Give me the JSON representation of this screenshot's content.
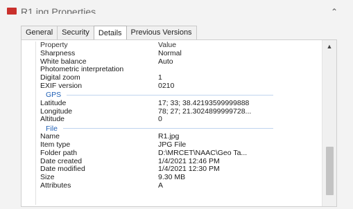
{
  "window": {
    "title": "R1.jpg Properties"
  },
  "tabs": [
    {
      "label": "General"
    },
    {
      "label": "Security"
    },
    {
      "label": "Details"
    },
    {
      "label": "Previous Versions"
    }
  ],
  "columns": {
    "property": "Property",
    "value": "Value"
  },
  "rows_image": [
    {
      "prop": "Sharpness",
      "val": "Normal"
    },
    {
      "prop": "White balance",
      "val": "Auto"
    },
    {
      "prop": "Photometric interpretation",
      "val": ""
    },
    {
      "prop": "Digital zoom",
      "val": "1"
    },
    {
      "prop": "EXIF version",
      "val": "0210"
    }
  ],
  "group_gps": "GPS",
  "rows_gps": [
    {
      "prop": "Latitude",
      "val": "17; 33; 38.42193599999888"
    },
    {
      "prop": "Longitude",
      "val": "78; 27; 21.3024899999728..."
    },
    {
      "prop": "Altitude",
      "val": "0"
    }
  ],
  "group_file": "File",
  "rows_file": [
    {
      "prop": "Name",
      "val": "R1.jpg"
    },
    {
      "prop": "Item type",
      "val": "JPG File"
    },
    {
      "prop": "Folder path",
      "val": "D:\\MRCET\\NAAC\\Geo Ta..."
    },
    {
      "prop": "Date created",
      "val": "1/4/2021 12:46 PM"
    },
    {
      "prop": "Date modified",
      "val": "1/4/2021 12:30 PM"
    },
    {
      "prop": "Size",
      "val": "9.30 MB"
    },
    {
      "prop": "Attributes",
      "val": "A"
    }
  ],
  "icons": {
    "chevron": "chevron-up-icon",
    "scroll_up": "scroll-up-arrow-icon"
  }
}
